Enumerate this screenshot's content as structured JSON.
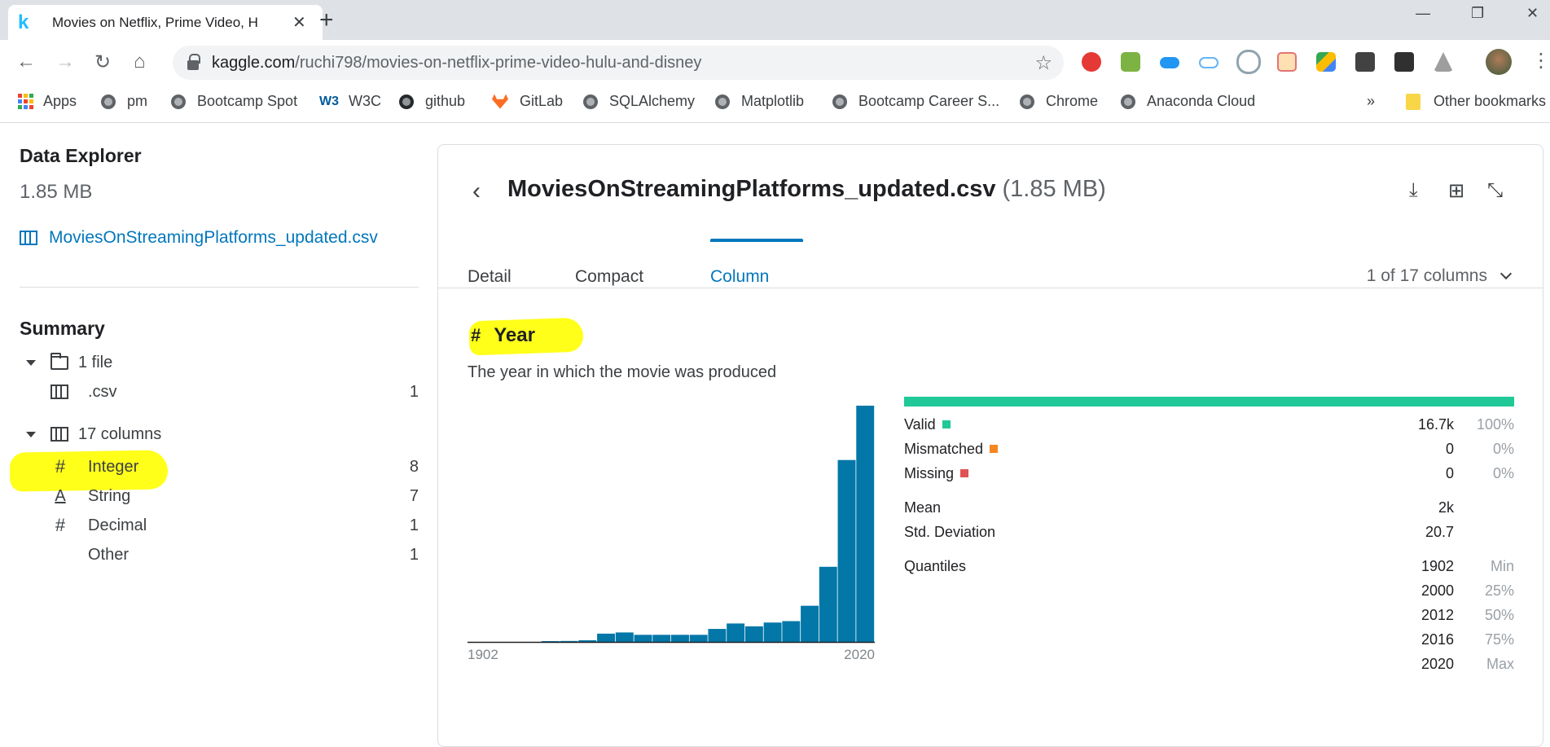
{
  "browser": {
    "tab_title": "Movies on Netflix, Prime Video, H",
    "url_host": "kaggle.com",
    "url_path": "/ruchi798/movies-on-netflix-prime-video-hulu-and-disney",
    "bookmarks": [
      "Apps",
      "pm",
      "Bootcamp Spot",
      "W3C",
      "github",
      "GitLab",
      "SQLAlchemy",
      "Matplotlib",
      "Bootcamp Career S...",
      "Chrome",
      "Anaconda Cloud"
    ],
    "more_bookmarks": "»",
    "other_bookmarks": "Other bookmarks"
  },
  "sidebar": {
    "title": "Data Explorer",
    "size": "1.85 MB",
    "file": "MoviesOnStreamingPlatforms_updated.csv",
    "summary_title": "Summary",
    "files_group": "1 file",
    "csv_label": ".csv",
    "csv_count": "1",
    "columns_group": "17 columns",
    "types": [
      {
        "label": "Integer",
        "count": "8",
        "icon": "hash-icon"
      },
      {
        "label": "String",
        "count": "7",
        "icon": "string-icon"
      },
      {
        "label": "Decimal",
        "count": "1",
        "icon": "hash-icon"
      },
      {
        "label": "Other",
        "count": "1",
        "icon": ""
      }
    ]
  },
  "main": {
    "file_name": "MoviesOnStreamingPlatforms_updated.csv",
    "file_size": "(1.85 MB)",
    "tabs": [
      "Detail",
      "Compact",
      "Column"
    ],
    "active_tab": "Column",
    "column_selector": "1 of 17 columns",
    "column": {
      "name": "Year",
      "description": "The year in which the movie was produced",
      "x_min_label": "1902",
      "x_max_label": "2020"
    },
    "stats": {
      "valid": {
        "label": "Valid",
        "value": "16.7k",
        "pct": "100%",
        "color": "#20c997"
      },
      "mismatched": {
        "label": "Mismatched",
        "value": "0",
        "pct": "0%",
        "color": "#f5871f"
      },
      "missing": {
        "label": "Missing",
        "value": "0",
        "pct": "0%",
        "color": "#e05252"
      },
      "mean_label": "Mean",
      "mean": "2k",
      "std_label": "Std. Deviation",
      "std": "20.7",
      "quantiles_label": "Quantiles",
      "quantiles": [
        {
          "value": "1902",
          "label": "Min"
        },
        {
          "value": "2000",
          "label": "25%"
        },
        {
          "value": "2012",
          "label": "50%"
        },
        {
          "value": "2016",
          "label": "75%"
        },
        {
          "value": "2020",
          "label": "Max"
        }
      ]
    },
    "valid_fraction": 1.0
  },
  "chart_data": {
    "type": "bar",
    "bar_color": "#0277a8",
    "xlim": [
      1902,
      2020
    ],
    "relative_heights": [
      0.0,
      0.0,
      0.0,
      0.0,
      0.002,
      0.004,
      0.007,
      0.035,
      0.04,
      0.03,
      0.03,
      0.03,
      0.03,
      0.055,
      0.078,
      0.066,
      0.082,
      0.088,
      0.153,
      0.318,
      0.77,
      1.0
    ]
  }
}
